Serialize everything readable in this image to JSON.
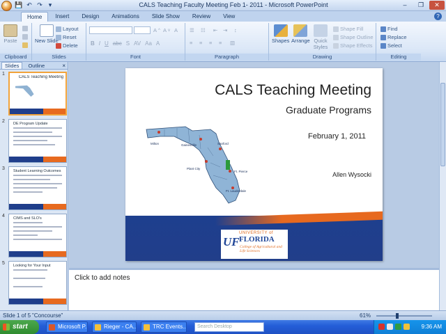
{
  "app": {
    "title": "CALS Teaching Faculty Meeting Feb 1- 2011 - Microsoft PowerPoint",
    "qat": [
      "💾",
      "↶",
      "↷",
      "▾"
    ],
    "controls": [
      "–",
      "❐",
      "✕"
    ]
  },
  "tabs": [
    {
      "label": "Home",
      "active": true
    },
    {
      "label": "Insert"
    },
    {
      "label": "Design"
    },
    {
      "label": "Animations"
    },
    {
      "label": "Slide Show"
    },
    {
      "label": "Review"
    },
    {
      "label": "View"
    }
  ],
  "ribbon": {
    "clipboard": {
      "label": "Clipboard",
      "paste": "Paste"
    },
    "slides": {
      "label": "Slides",
      "new_slide": "New Slide",
      "layout": "Layout",
      "reset": "Reset",
      "delete": "Delete"
    },
    "font": {
      "label": "Font",
      "bold": "B",
      "italic": "I",
      "underline": "U",
      "strike": "abc",
      "shadow": "S",
      "spacing": "AV",
      "case": "Aa",
      "color": "A"
    },
    "paragraph": {
      "label": "Paragraph"
    },
    "drawing": {
      "label": "Drawing",
      "shapes": "Shapes",
      "arrange": "Arrange",
      "quick_styles": "Quick Styles",
      "shape_fill": "Shape Fill",
      "shape_outline": "Shape Outline",
      "shape_effects": "Shape Effects"
    },
    "editing": {
      "label": "Editing",
      "find": "Find",
      "replace": "Replace",
      "select": "Select"
    }
  },
  "left_pane": {
    "tabs": [
      "Slides",
      "Outline"
    ],
    "close": "×",
    "thumbnails": [
      {
        "num": "1",
        "title": "CALS Teaching Meeting"
      },
      {
        "num": "2",
        "title": "DE Program Update"
      },
      {
        "num": "3",
        "title": "Student Learning Outcomes"
      },
      {
        "num": "4",
        "title": "CIMS and SLO's"
      },
      {
        "num": "5",
        "title": "Looking for Your Input"
      }
    ]
  },
  "slide": {
    "title": "CALS Teaching Meeting",
    "subtitle": "Graduate Programs",
    "date": "February 1, 2011",
    "author": "Allen Wysocki",
    "map_labels": [
      "Milton",
      "Gainesville",
      "Sanford",
      "Ft. Pierce",
      "Ft. Lauderdale",
      "Plant City"
    ],
    "logo": {
      "uf": "UF",
      "university_of": "UNIVERSITY of",
      "florida": "FLORIDA",
      "college": "College of Agricultural and Life Sciences"
    }
  },
  "notes": {
    "placeholder": "Click to add notes"
  },
  "status": {
    "slide": "Slide 1 of 5",
    "theme": "\"Concourse\"",
    "zoom": "61%"
  },
  "taskbar": {
    "start": "start",
    "tasks": [
      "Microsoft P...",
      "Rieger - CA...",
      "TRC Events..."
    ],
    "search_placeholder": "Search Desktop",
    "clock": "9:36 AM"
  }
}
